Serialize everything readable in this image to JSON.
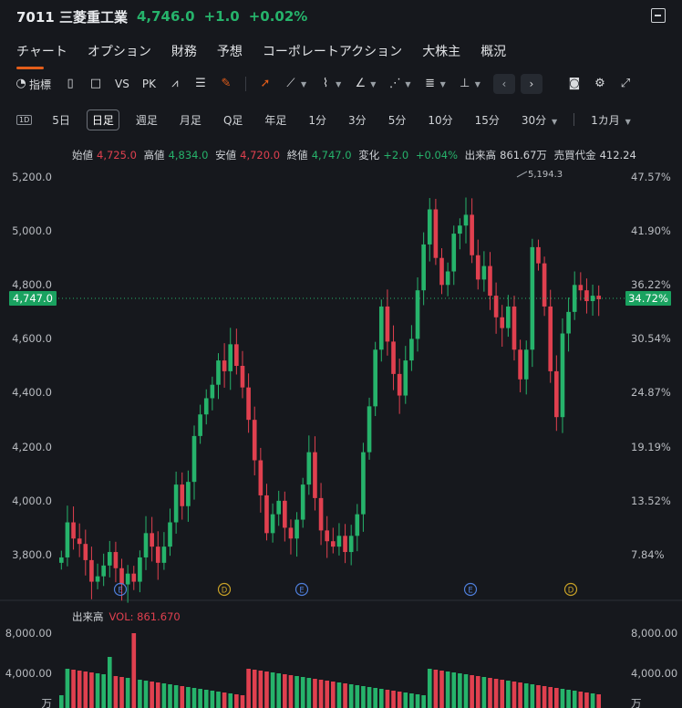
{
  "header": {
    "symbol": "7011 三菱重工業",
    "price": "4,746.0",
    "change": "+1.0",
    "change_pct": "+0.02%"
  },
  "tabs": [
    "チャート",
    "オプション",
    "財務",
    "予想",
    "コーポレートアクション",
    "大株主",
    "概況"
  ],
  "toolbar": {
    "indicators": "指標",
    "vs": "VS",
    "pk": "PK"
  },
  "intervals": [
    "5日",
    "日足",
    "週足",
    "月足",
    "Q足",
    "年足",
    "1分",
    "3分",
    "5分",
    "10分",
    "15分",
    "30分",
    "1カ月"
  ],
  "interval_box": "1D",
  "selected_interval": "日足",
  "ohlc": {
    "open_label": "始値",
    "open": "4,725.0",
    "high_label": "高値",
    "high": "4,834.0",
    "low_label": "安値",
    "low": "4,720.0",
    "close_label": "終値",
    "close": "4,747.0",
    "chg_label": "変化",
    "chg": "+2.0",
    "chg_pct": "+0.04%",
    "vol_label": "出来高",
    "vol": "861.67万",
    "turnover_label": "売買代金",
    "turnover": "412.24"
  },
  "volume_panel": {
    "title": "出来高",
    "vol_text": "VOL: 861.670",
    "ticks": [
      "8,000.00",
      "4,000.00"
    ],
    "unit": "万"
  },
  "colors": {
    "up": "#26b36b",
    "down": "#e0404f",
    "accent": "#e35d1a",
    "bg": "#16181d"
  },
  "chart_data": {
    "type": "candlestick",
    "y_ticks": [
      "5,200.0",
      "5,000.0",
      "4,800.0",
      "4,600.0",
      "4,400.0",
      "4,200.0",
      "4,000.0",
      "3,800.0"
    ],
    "pct_ticks": [
      "47.57%",
      "41.90%",
      "36.22%",
      "30.54%",
      "24.87%",
      "19.19%",
      "13.52%",
      "7.84%"
    ],
    "ylim": [
      3650,
      5260
    ],
    "last_price": "4,747.0",
    "last_pct": "34.72%",
    "high_marker": "5,194.3",
    "event_markers": [
      "E",
      "D",
      "E",
      "E",
      "D"
    ],
    "closes": [
      3790,
      3920,
      3860,
      3840,
      3780,
      3700,
      3720,
      3760,
      3810,
      3750,
      3690,
      3730,
      3700,
      3790,
      3880,
      3830,
      3770,
      3830,
      3920,
      4060,
      3980,
      4070,
      4240,
      4320,
      4380,
      4430,
      4520,
      4480,
      4580,
      4500,
      4420,
      4300,
      4150,
      4020,
      3880,
      3950,
      4000,
      3900,
      3860,
      3930,
      4060,
      4180,
      4010,
      3890,
      3850,
      3830,
      3870,
      3810,
      3870,
      3950,
      4180,
      4350,
      4560,
      4720,
      4590,
      4470,
      4390,
      4520,
      4600,
      4780,
      4950,
      5080,
      4900,
      4800,
      4850,
      4990,
      5020,
      5060,
      4910,
      4820,
      4870,
      4760,
      4680,
      4640,
      4720,
      4560,
      4450,
      4560,
      4940,
      4880,
      4720,
      4480,
      4310,
      4620,
      4700,
      4800,
      4780,
      4740,
      4760,
      4747
    ]
  }
}
